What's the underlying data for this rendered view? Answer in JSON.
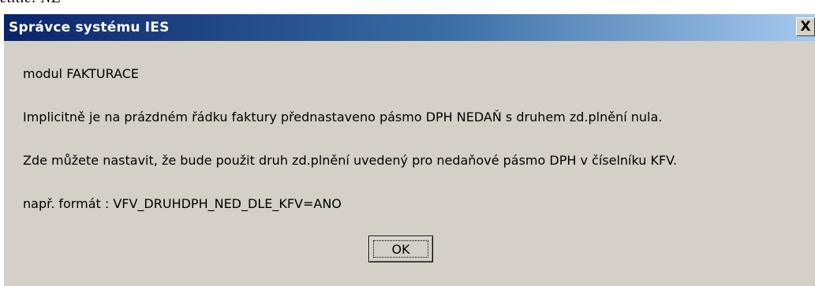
{
  "background": {
    "text": "etitle: NE"
  },
  "dialog": {
    "title": "Správce systému IES",
    "close_label": "X",
    "lines": [
      "modul FAKTURACE",
      "Implicitně je na prázdném řádku faktury přednastaveno pásmo DPH NEDAŇ s druhem zd.plnění nula.",
      "Zde můžete nastavit, že bude použit druh zd.plnění uvedený pro nedaňové pásmo DPH v číselníku KFV.",
      "např. formát : VFV_DRUHDPH_NED_DLE_KFV=ANO"
    ],
    "ok_label": "OK"
  },
  "colors": {
    "title_bar_start": "#0a246a",
    "title_bar_end": "#a6caf0",
    "dialog_face": "#d4d0c8"
  }
}
